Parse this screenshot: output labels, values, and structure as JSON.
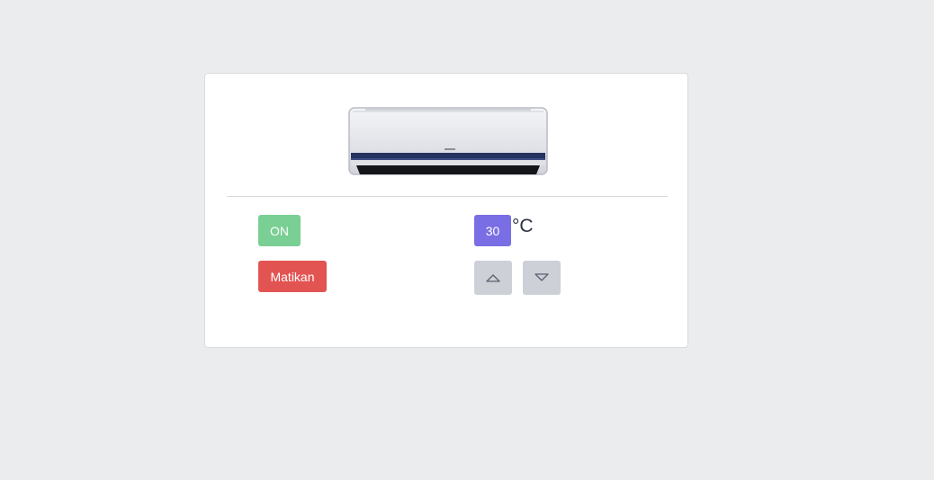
{
  "status": {
    "label": "ON",
    "color": "#7acf94"
  },
  "power_button": {
    "label": "Matikan",
    "color": "#e25452"
  },
  "temperature": {
    "value": "30",
    "unit": "°C",
    "badge_color": "#7a6ee4"
  },
  "controls": {
    "up_icon": "triangle-up-icon",
    "down_icon": "triangle-down-icon",
    "button_color": "#cdd0d6"
  },
  "image": {
    "icon": "air-conditioner-icon"
  }
}
